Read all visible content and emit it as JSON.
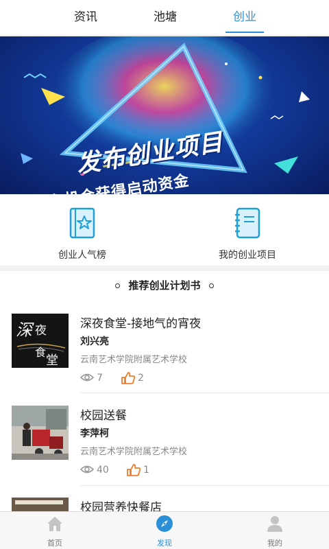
{
  "top_tabs": [
    {
      "label": "资讯",
      "active": false
    },
    {
      "label": "池塘",
      "active": false
    },
    {
      "label": "创业",
      "active": true
    }
  ],
  "banner": {
    "title": "发布创业项目",
    "subtitle": "有机会获得启动资金"
  },
  "entries": [
    {
      "label": "创业人气榜",
      "icon": "star-book-icon"
    },
    {
      "label": "我的创业项目",
      "icon": "notebook-icon"
    }
  ],
  "section": {
    "title": "推荐创业计划书"
  },
  "items": [
    {
      "title": "深夜食堂-接地气的宵夜",
      "author": "刘兴亮",
      "org": "云南艺术学院附属艺术学校",
      "views": "7",
      "likes": "2",
      "thumb_text": "深夜食堂"
    },
    {
      "title": "校园送餐",
      "author": "李萍柯",
      "org": "云南艺术学院附属艺术学校",
      "views": "40",
      "likes": "1"
    },
    {
      "title": "校园营养快餐店"
    }
  ],
  "bottom_nav": [
    {
      "label": "首页",
      "icon": "home-icon",
      "active": false
    },
    {
      "label": "发现",
      "icon": "compass-icon",
      "active": true
    },
    {
      "label": "我的",
      "icon": "user-icon",
      "active": false
    }
  ],
  "colors": {
    "accent": "#2a8fd6",
    "like": "#f07c2a"
  }
}
